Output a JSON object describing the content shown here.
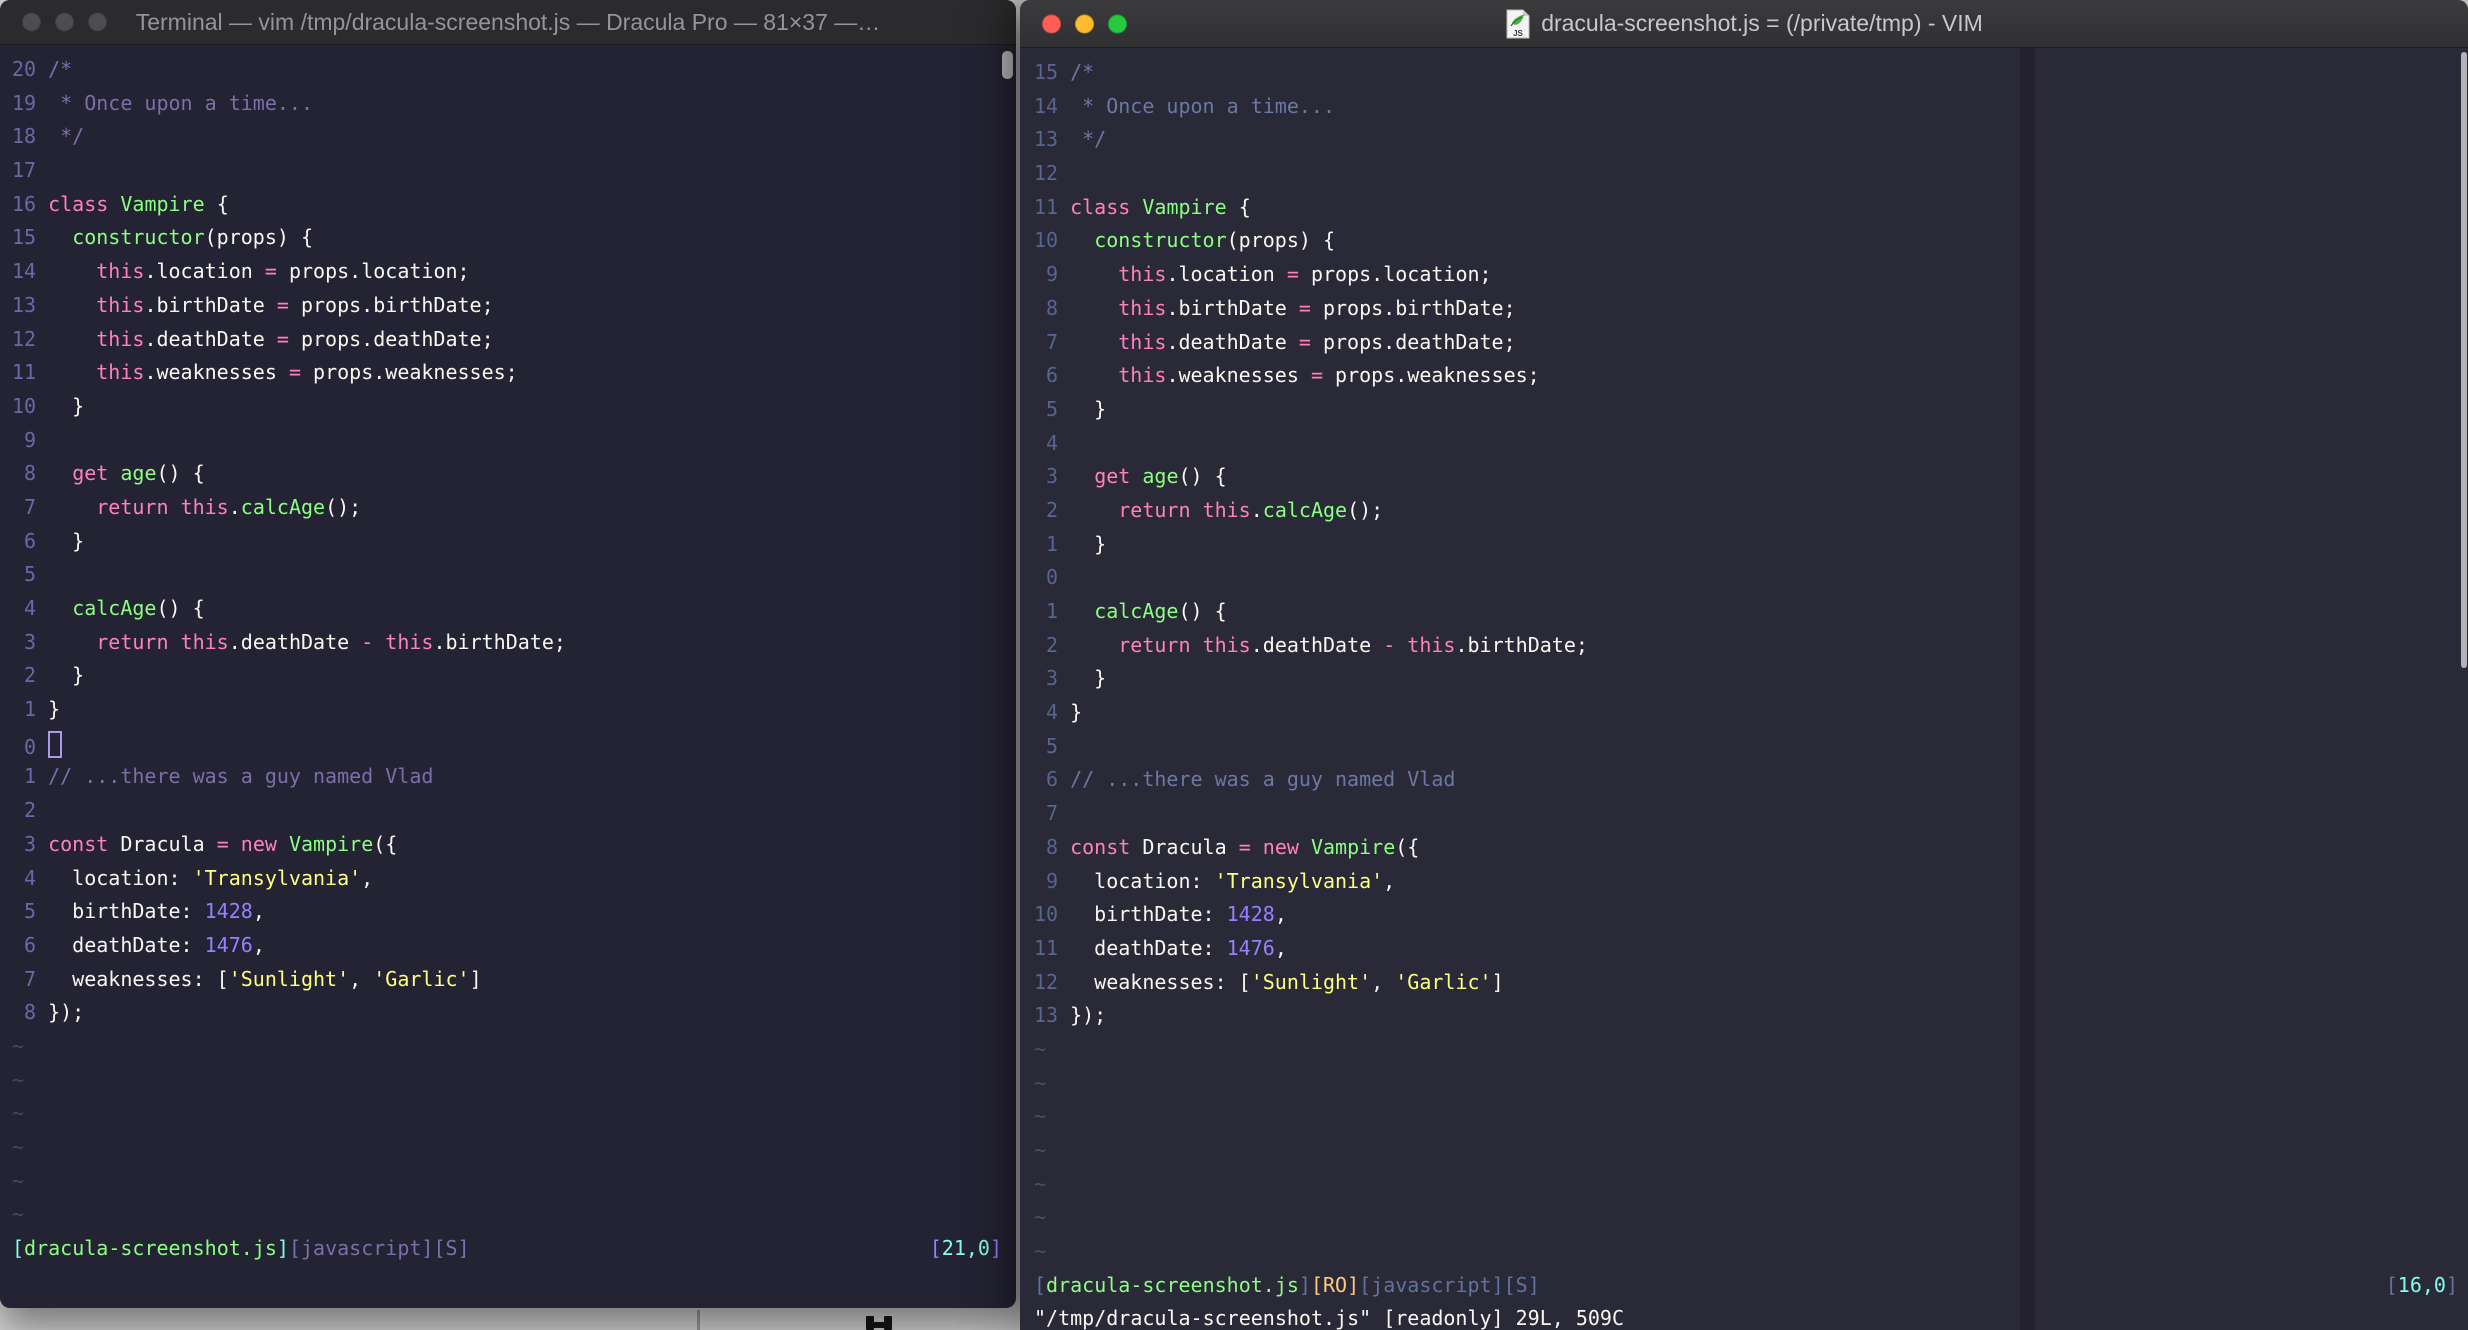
{
  "windows": {
    "left": {
      "title": "Terminal — vim /tmp/dracula-screenshot.js — Dracula Pro — 81×37 —…",
      "traffic_lights": "inactive-gray",
      "gutters": [
        "20",
        "19",
        "18",
        "17",
        "16",
        "15",
        "14",
        "13",
        "12",
        "11",
        "10",
        " 9",
        " 8",
        " 7",
        " 6",
        " 5",
        " 4",
        " 3",
        " 2",
        " 1",
        " 0",
        " 1",
        " 2",
        " 3",
        " 4",
        " 5",
        " 6",
        " 7",
        " 8"
      ],
      "cursor_line": 20,
      "cursor_visible": true,
      "cursor_style": "hollow-block",
      "tilde_count": 6,
      "status_left": [
        [
          "cy",
          "["
        ],
        [
          "g",
          "dracula-screenshot.js"
        ],
        [
          "cy",
          "]"
        ],
        [
          "mu",
          "[javascript][S]"
        ]
      ],
      "status_right": [
        [
          "pu",
          "["
        ],
        [
          "cy",
          "21,0"
        ],
        [
          "pu",
          "]"
        ]
      ],
      "cmdline": ""
    },
    "right": {
      "title": "dracula-screenshot.js = (/private/tmp) - VIM",
      "traffic_lights": "active-colored",
      "file_icon": "js-document-icon",
      "gutters": [
        "15",
        "14",
        "13",
        "12",
        "11",
        "10",
        " 9",
        " 8",
        " 7",
        " 6",
        " 5",
        " 4",
        " 3",
        " 2",
        " 1",
        " 0",
        " 1",
        " 2",
        " 3",
        " 4",
        " 5",
        " 6",
        " 7",
        " 8",
        " 9",
        "10",
        "11",
        "12",
        "13"
      ],
      "cursor_line": 15,
      "cursor_visible": false,
      "tilde_count": 7,
      "status_left": [
        [
          "mu",
          "["
        ],
        [
          "g",
          "dracula-screenshot.js"
        ],
        [
          "mu",
          "]"
        ],
        [
          "or",
          "[RO]"
        ],
        [
          "mu",
          "[javascript][S]"
        ]
      ],
      "status_right": [
        [
          "mu",
          "["
        ],
        [
          "cy",
          "16,0"
        ],
        [
          "mu",
          "]"
        ]
      ],
      "cmdline": "\"/tmp/dracula-screenshot.js\" [readonly] 29L, 509C"
    }
  },
  "code_lines": [
    [
      [
        "c",
        "/*"
      ]
    ],
    [
      [
        "c",
        " * Once upon a time..."
      ]
    ],
    [
      [
        "c",
        " */"
      ]
    ],
    [],
    [
      [
        "k",
        "class"
      ],
      [
        "w",
        " "
      ],
      [
        "g",
        "Vampire"
      ],
      [
        "w",
        " {"
      ]
    ],
    [
      [
        "w",
        "  "
      ],
      [
        "g",
        "constructor"
      ],
      [
        "w",
        "(props) {"
      ]
    ],
    [
      [
        "w",
        "    "
      ],
      [
        "k",
        "this"
      ],
      [
        "w",
        ".location "
      ],
      [
        "k",
        "="
      ],
      [
        "w",
        " props.location;"
      ]
    ],
    [
      [
        "w",
        "    "
      ],
      [
        "k",
        "this"
      ],
      [
        "w",
        ".birthDate "
      ],
      [
        "k",
        "="
      ],
      [
        "w",
        " props.birthDate;"
      ]
    ],
    [
      [
        "w",
        "    "
      ],
      [
        "k",
        "this"
      ],
      [
        "w",
        ".deathDate "
      ],
      [
        "k",
        "="
      ],
      [
        "w",
        " props.deathDate;"
      ]
    ],
    [
      [
        "w",
        "    "
      ],
      [
        "k",
        "this"
      ],
      [
        "w",
        ".weaknesses "
      ],
      [
        "k",
        "="
      ],
      [
        "w",
        " props.weaknesses;"
      ]
    ],
    [
      [
        "w",
        "  }"
      ]
    ],
    [],
    [
      [
        "w",
        "  "
      ],
      [
        "k",
        "get"
      ],
      [
        "w",
        " "
      ],
      [
        "g",
        "age"
      ],
      [
        "w",
        "() {"
      ]
    ],
    [
      [
        "w",
        "    "
      ],
      [
        "k",
        "return"
      ],
      [
        "w",
        " "
      ],
      [
        "k",
        "this"
      ],
      [
        "w",
        "."
      ],
      [
        "g",
        "calcAge"
      ],
      [
        "w",
        "();"
      ]
    ],
    [
      [
        "w",
        "  }"
      ]
    ],
    [],
    [
      [
        "w",
        "  "
      ],
      [
        "g",
        "calcAge"
      ],
      [
        "w",
        "() {"
      ]
    ],
    [
      [
        "w",
        "    "
      ],
      [
        "k",
        "return"
      ],
      [
        "w",
        " "
      ],
      [
        "k",
        "this"
      ],
      [
        "w",
        ".deathDate "
      ],
      [
        "k",
        "-"
      ],
      [
        "w",
        " "
      ],
      [
        "k",
        "this"
      ],
      [
        "w",
        ".birthDate;"
      ]
    ],
    [
      [
        "w",
        "  }"
      ]
    ],
    [
      [
        "w",
        "}"
      ]
    ],
    [],
    [
      [
        "c",
        "// ...there was a guy named Vlad"
      ]
    ],
    [],
    [
      [
        "k",
        "const"
      ],
      [
        "w",
        " Dracula "
      ],
      [
        "k",
        "="
      ],
      [
        "w",
        " "
      ],
      [
        "k",
        "new"
      ],
      [
        "w",
        " "
      ],
      [
        "g",
        "Vampire"
      ],
      [
        "w",
        "({"
      ]
    ],
    [
      [
        "w",
        "  location: "
      ],
      [
        "s",
        "'Transylvania'"
      ],
      [
        "w",
        ","
      ]
    ],
    [
      [
        "w",
        "  birthDate: "
      ],
      [
        "n",
        "1428"
      ],
      [
        "w",
        ","
      ]
    ],
    [
      [
        "w",
        "  deathDate: "
      ],
      [
        "n",
        "1476"
      ],
      [
        "w",
        ","
      ]
    ],
    [
      [
        "w",
        "  weaknesses: ["
      ],
      [
        "s",
        "'Sunlight'"
      ],
      [
        "w",
        ", "
      ],
      [
        "s",
        "'Garlic'"
      ],
      [
        "w",
        "]"
      ]
    ],
    [
      [
        "w",
        "});"
      ]
    ]
  ],
  "palette": {
    "bg_left": "#242333",
    "bg_right": "#2A2937",
    "foreground": "#F8F8F2",
    "pink": "#FF80BF",
    "green": "#8AFF80",
    "yellow": "#FFFF80",
    "purple": "#9580FF",
    "cyan": "#80FFEA",
    "orange": "#FFCA80",
    "comment_left": "#7970A9",
    "comment_right": "#6C77A3",
    "traffic_red": "#FF5F57",
    "traffic_yellow": "#FEBC2E",
    "traffic_green": "#28C840"
  }
}
